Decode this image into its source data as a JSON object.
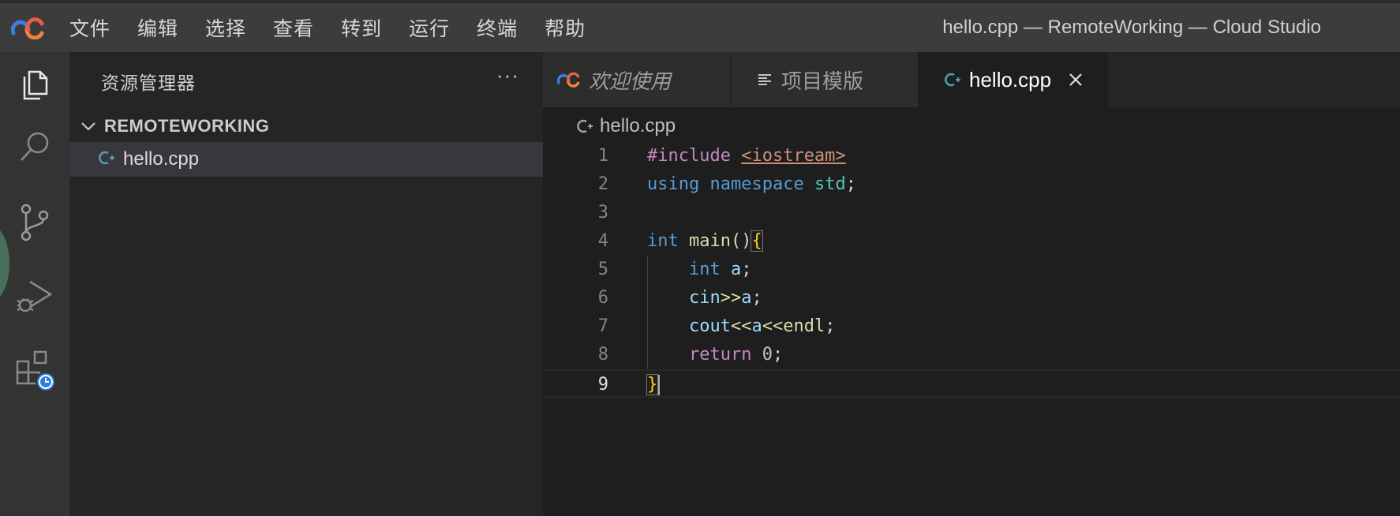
{
  "window": {
    "title": "hello.cpp — RemoteWorking — Cloud Studio"
  },
  "menu": [
    "文件",
    "编辑",
    "选择",
    "查看",
    "转到",
    "运行",
    "终端",
    "帮助"
  ],
  "activity_bar": {
    "items": [
      {
        "name": "explorer-icon",
        "active": true
      },
      {
        "name": "search-icon"
      },
      {
        "name": "source-control-icon"
      },
      {
        "name": "run-debug-icon"
      },
      {
        "name": "extensions-icon"
      }
    ]
  },
  "sidebar": {
    "title": "资源管理器",
    "more": "···",
    "folder": "REMOTEWORKING",
    "files": [
      {
        "name": "hello.cpp",
        "selected": true
      }
    ]
  },
  "tabs": [
    {
      "label": "欢迎使用",
      "active": false,
      "italic": true
    },
    {
      "label": "项目模版",
      "active": false,
      "italic": false
    },
    {
      "label": "hello.cpp",
      "active": true,
      "italic": false
    }
  ],
  "breadcrumb": {
    "file": "hello.cpp"
  },
  "editor": {
    "current_line": 9,
    "line_numbers": [
      "1",
      "2",
      "3",
      "4",
      "5",
      "6",
      "7",
      "8",
      "9"
    ],
    "tokens": {
      "l1_pre": "#include",
      "l1_sp": " ",
      "l1_inc": "<iostream>",
      "l2_using": "using",
      "l2_namespace": "namespace",
      "l2_std": "std",
      "l2_semi": ";",
      "l4_int": "int",
      "l4_main": "main",
      "l4_paren": "()",
      "l4_brace": "{",
      "l5_int": "int",
      "l5_a": "a",
      "l5_semi": ";",
      "l6_cin": "cin",
      "l6_op": ">>",
      "l6_a": "a",
      "l6_semi": ";",
      "l7_cout": "cout",
      "l7_op1": "<<",
      "l7_a": "a",
      "l7_op2": "<<",
      "l7_endl": "endl",
      "l7_semi": ";",
      "l8_return": "return",
      "l8_zero": "0",
      "l8_semi": ";",
      "l9_brace": "}"
    }
  },
  "colors": {
    "accent_logo_blue": "#3c7ddf",
    "accent_logo_orange": "#f0853a",
    "cpp_icon": "#519aba",
    "clock_badge": "#2f7fd8"
  }
}
